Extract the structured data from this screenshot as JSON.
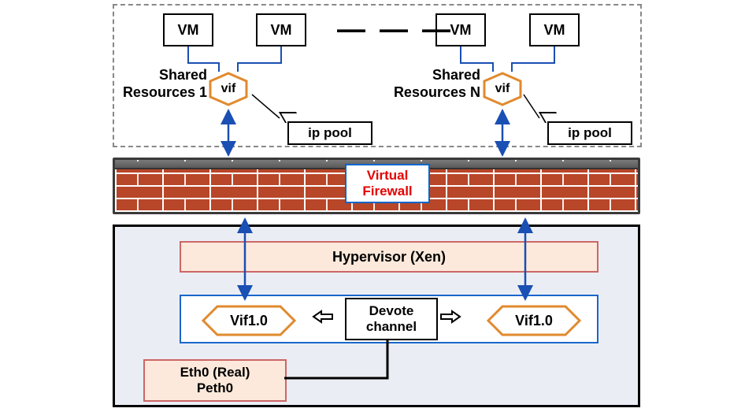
{
  "vm_label": "VM",
  "vif_label": "vif",
  "ippool_label": "ip pool",
  "shared1_line1": "Shared",
  "shared1_line2": "Resources 1",
  "sharedN_line1": "Shared",
  "sharedN_line2": "Resources N",
  "dashes": "— — —",
  "vfw_line1": "Virtual",
  "vfw_line2": "Firewall",
  "hypervisor": "Hypervisor (Xen)",
  "devote_line1": "Devote",
  "devote_line2": "channel",
  "vif10": "Vif1.0",
  "eth_line1": "Eth0 (Real)",
  "eth_line2": "Peth0"
}
